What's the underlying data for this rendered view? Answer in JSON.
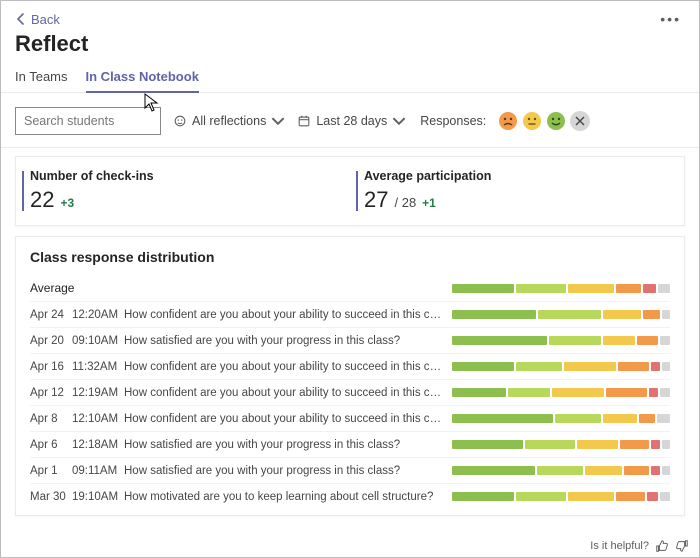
{
  "back_label": "Back",
  "page_title": "Reflect",
  "tabs": {
    "in_teams": "In Teams",
    "in_class_notebook": "In Class Notebook"
  },
  "toolbar": {
    "search_placeholder": "Search students",
    "all_reflections": "All reflections",
    "last_28_days": "Last 28 days",
    "responses_label": "Responses:"
  },
  "stats": {
    "checkins_title": "Number of check-ins",
    "checkins_value": "22",
    "checkins_delta": "+3",
    "participation_title": "Average participation",
    "participation_value": "27",
    "participation_total": "/ 28",
    "participation_delta": "+1"
  },
  "distribution_title": "Class response distribution",
  "rows": {
    "average_label": "Average",
    "r0": {
      "date": "Apr 24",
      "time": "12:20AM",
      "q": "How confident are you about your ability to succeed in this class?"
    },
    "r1": {
      "date": "Apr 20",
      "time": "09:10AM",
      "q": "How satisfied are you with your progress in this class?"
    },
    "r2": {
      "date": "Apr 16",
      "time": "11:32AM",
      "q": "How confident are you about your ability to succeed in this class?"
    },
    "r3": {
      "date": "Apr 12",
      "time": "12:19AM",
      "q": "How confident are you about your ability to succeed in this class?"
    },
    "r4": {
      "date": "Apr 8",
      "time": "12:10AM",
      "q": "How confident are you about your ability to succeed in this class?"
    },
    "r5": {
      "date": "Apr 6",
      "time": "12:18AM",
      "q": "How satisfied are you with your progress in this class?"
    },
    "r6": {
      "date": "Apr 1",
      "time": "09:11AM",
      "q": "How satisfied are you with your progress in this class?"
    },
    "r7": {
      "date": "Mar 30",
      "time": "19:10AM",
      "q": "How motivated are you to keep learning about cell structure?"
    }
  },
  "chart_data": {
    "type": "bar",
    "note": "stacked horizontal distribution, 5 sentiment buckets + no-response; values are % of bar width",
    "categories": [
      "very_positive",
      "positive",
      "neutral",
      "negative",
      "very_negative",
      "no_response"
    ],
    "series": [
      {
        "name": "Average",
        "values": [
          30,
          24,
          22,
          12,
          6,
          6
        ]
      },
      {
        "name": "Apr 24 12:20AM",
        "values": [
          40,
          30,
          18,
          8,
          0,
          4
        ]
      },
      {
        "name": "Apr 20 09:10AM",
        "values": [
          45,
          25,
          15,
          10,
          0,
          5
        ]
      },
      {
        "name": "Apr 16 11:32AM",
        "values": [
          30,
          22,
          25,
          15,
          4,
          4
        ]
      },
      {
        "name": "Apr 12 12:19AM",
        "values": [
          26,
          20,
          25,
          20,
          4,
          5
        ]
      },
      {
        "name": "Apr 8 12:10AM",
        "values": [
          48,
          22,
          16,
          8,
          0,
          6
        ]
      },
      {
        "name": "Apr 6 12:18AM",
        "values": [
          34,
          24,
          20,
          14,
          4,
          4
        ]
      },
      {
        "name": "Apr 1 09:11AM",
        "values": [
          40,
          22,
          18,
          12,
          4,
          4
        ]
      },
      {
        "name": "Mar 30 19:10AM",
        "values": [
          30,
          24,
          22,
          14,
          5,
          5
        ]
      }
    ],
    "colors": {
      "very_positive": "#8cbf4e",
      "positive": "#b7d85b",
      "neutral": "#f2c94c",
      "negative": "#f2994a",
      "very_negative": "#e27272",
      "no_response": "#d6d6d6"
    }
  },
  "footer": {
    "helpful": "Is it helpful?"
  }
}
